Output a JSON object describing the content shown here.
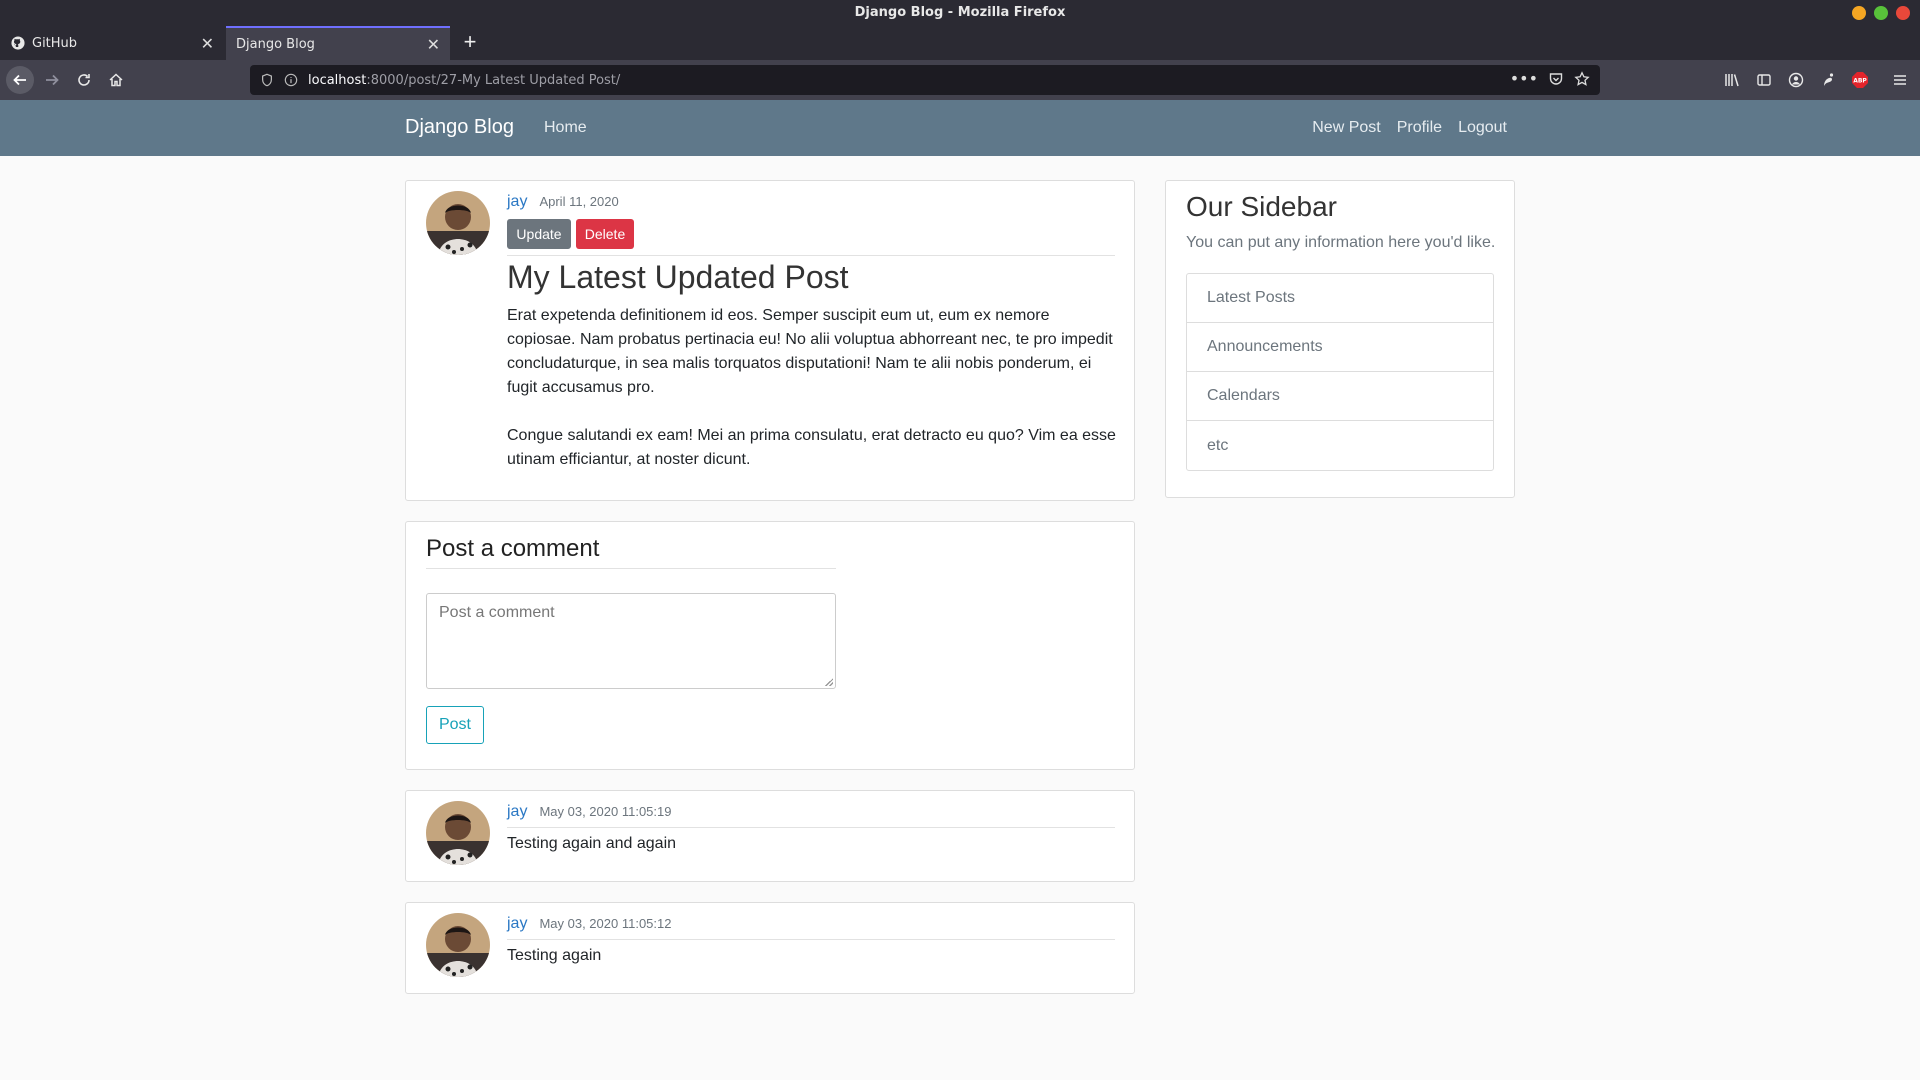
{
  "window": {
    "title": "Django Blog - Mozilla Firefox"
  },
  "browser": {
    "tabs": [
      {
        "title": "GitHub",
        "icon": "github-icon"
      },
      {
        "title": "Django Blog",
        "icon": ""
      }
    ],
    "url": {
      "host": "localhost",
      "rest": ":8000/post/27-My Latest Updated Post/"
    }
  },
  "site": {
    "brand": "Django Blog",
    "nav": {
      "home": "Home",
      "new_post": "New Post",
      "profile": "Profile",
      "logout": "Logout"
    }
  },
  "post": {
    "author": "jay",
    "date": "April 11, 2020",
    "update_label": "Update",
    "delete_label": "Delete",
    "title": "My Latest Updated Post",
    "paragraphs": [
      "Erat expetenda definitionem id eos. Semper suscipit eum ut, eum ex nemore copiosae. Nam probatus pertinacia eu! No alii voluptua abhorreant nec, te pro impedit concludaturque, in sea malis torquatos disputationi! Nam te alii nobis ponderum, ei fugit accusamus pro.",
      "Congue salutandi ex eam! Mei an prima consulatu, erat detracto eu quo? Vim ea esse utinam efficiantur, at noster dicunt."
    ]
  },
  "comment_form": {
    "heading": "Post a comment",
    "placeholder": "Post a comment",
    "submit_label": "Post"
  },
  "comments": [
    {
      "author": "jay",
      "date": "May 03, 2020 11:05:19",
      "text": "Testing again and again"
    },
    {
      "author": "jay",
      "date": "May 03, 2020 11:05:12",
      "text": "Testing again"
    }
  ],
  "sidebar": {
    "title": "Our Sidebar",
    "text": "You can put any information here you'd like.",
    "items": [
      "Latest Posts",
      "Announcements",
      "Calendars",
      "etc"
    ]
  },
  "colors": {
    "site_nav": "#5f788a",
    "link": "#2b78c4",
    "danger": "#dc3545",
    "secondary": "#6c757d",
    "info": "#17a2b8"
  }
}
